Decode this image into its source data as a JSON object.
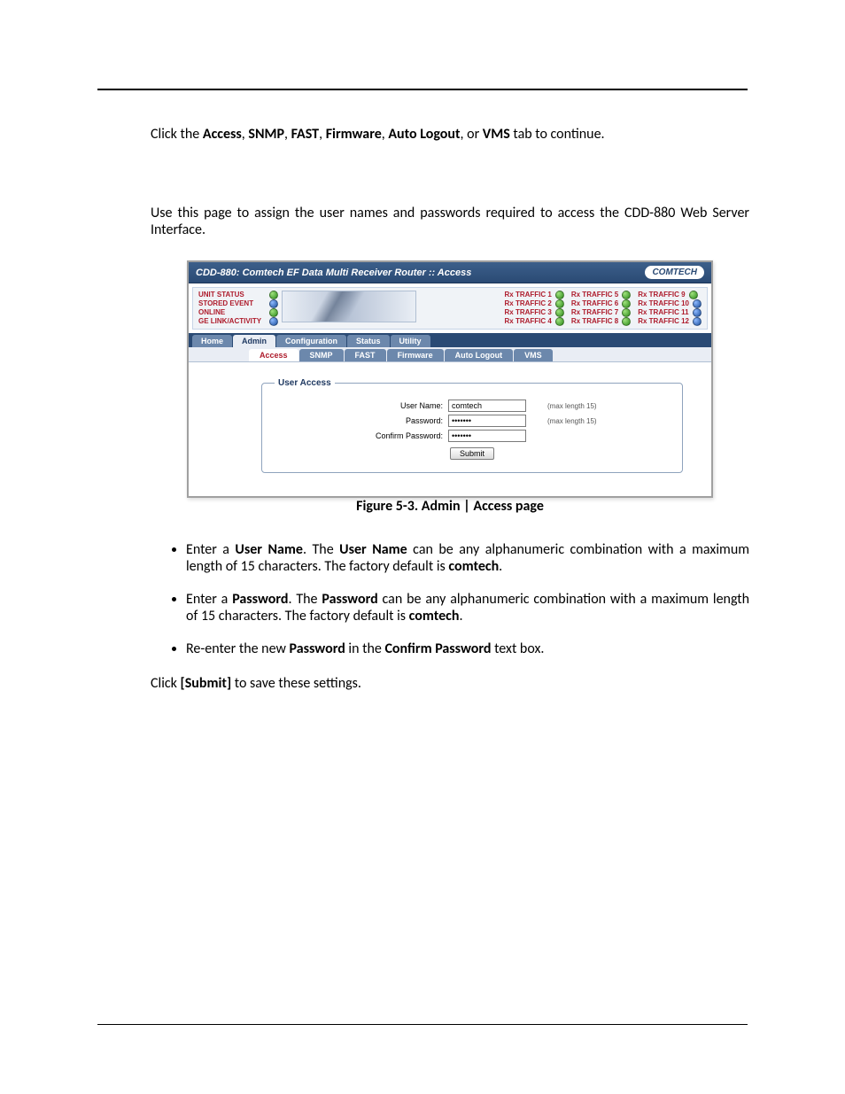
{
  "intro_prefix": "Click the ",
  "intro_tabs": [
    "Access",
    "SNMP",
    "FAST",
    "Firmware",
    "Auto Logout",
    "VMS"
  ],
  "intro_suffix": " tab to continue.",
  "use_page_text": "Use this page to assign the user names and passwords required to access the CDD-880 Web Server Interface.",
  "figure_caption": "Figure 5-3. Admin | Access page",
  "bullet1_pre": "Enter a ",
  "bullet1_b1": "User Name",
  "bullet1_mid": ". The ",
  "bullet1_b2": "User Name",
  "bullet1_post": " can be any alphanumeric combination with a maximum length of 15 characters. The factory default is ",
  "bullet1_default": "comtech",
  "bullet2_pre": "Enter a ",
  "bullet2_b1": "Password",
  "bullet2_mid": ". The ",
  "bullet2_b2": "Password",
  "bullet2_post": " can be any alphanumeric combination with a maximum length of 15 characters. The factory default is ",
  "bullet2_default": "comtech",
  "bullet3_pre": "Re-enter the new ",
  "bullet3_b1": "Password",
  "bullet3_mid": " in the ",
  "bullet3_b2": "Confirm Password",
  "bullet3_post": " text box.",
  "submit_text_pre": "Click ",
  "submit_text_b": "[Submit]",
  "submit_text_post": " to save these settings.",
  "shot": {
    "title": "CDD-880: Comtech EF Data Multi Receiver Router :: Access",
    "logo": "COMTECH",
    "status_left": [
      "UNIT STATUS",
      "STORED EVENT",
      "ONLINE",
      "GE LINK/ACTIVITY"
    ],
    "rx_col1": [
      "Rx TRAFFIC 1",
      "Rx TRAFFIC 2",
      "Rx TRAFFIC 3",
      "Rx TRAFFIC 4"
    ],
    "rx_col2": [
      "Rx TRAFFIC 5",
      "Rx TRAFFIC 6",
      "Rx TRAFFIC 7",
      "Rx TRAFFIC 8"
    ],
    "rx_col3": [
      "Rx TRAFFIC 9",
      "Rx TRAFFIC 10",
      "Rx TRAFFIC 11",
      "Rx TRAFFIC 12"
    ],
    "tabs1": [
      "Home",
      "Admin",
      "Configuration",
      "Status",
      "Utility"
    ],
    "tabs1_active": "Admin",
    "tabs2": [
      "Access",
      "SNMP",
      "FAST",
      "Firmware",
      "Auto Logout",
      "VMS"
    ],
    "tabs2_active": "Access",
    "fieldset": "User Access",
    "labels": {
      "user": "User Name:",
      "pass": "Password:",
      "confirm": "Confirm Password:"
    },
    "values": {
      "user": "comtech",
      "pass": "•••••••",
      "confirm": "•••••••"
    },
    "hint": "(max length 15)",
    "submit": "Submit"
  }
}
